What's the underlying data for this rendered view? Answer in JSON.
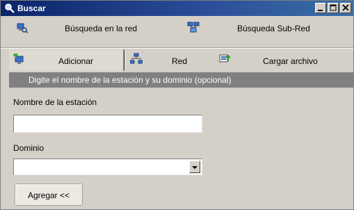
{
  "window": {
    "title": "Buscar",
    "icon": "search-icon",
    "controls": [
      "minimize",
      "maximize",
      "close"
    ]
  },
  "toolbar": {
    "network_search_label": "Búsqueda en la red",
    "network_search_icon": "network-search-icon",
    "subnet_search_label": "Búsqueda Sub-Red",
    "subnet_search_icon": "subnet-search-icon"
  },
  "tabs": {
    "add_label": "Adicionar",
    "add_icon": "add-station-icon",
    "network_label": "Red",
    "network_icon": "network-icon",
    "upload_label": "Cargar archivo",
    "upload_icon": "upload-file-icon",
    "active": "Adicionar"
  },
  "form": {
    "hint": "Digite el nombre de la estación y su dominio (opcional)",
    "station_label": "Nombre de la estación",
    "station_value": "",
    "domain_label": "Dominio",
    "domain_value": "",
    "submit_label": "Agregar <<"
  },
  "colors": {
    "titlebar": "#0a246a",
    "window_bg": "#d4d0c8",
    "hint_bar": "#808080"
  }
}
